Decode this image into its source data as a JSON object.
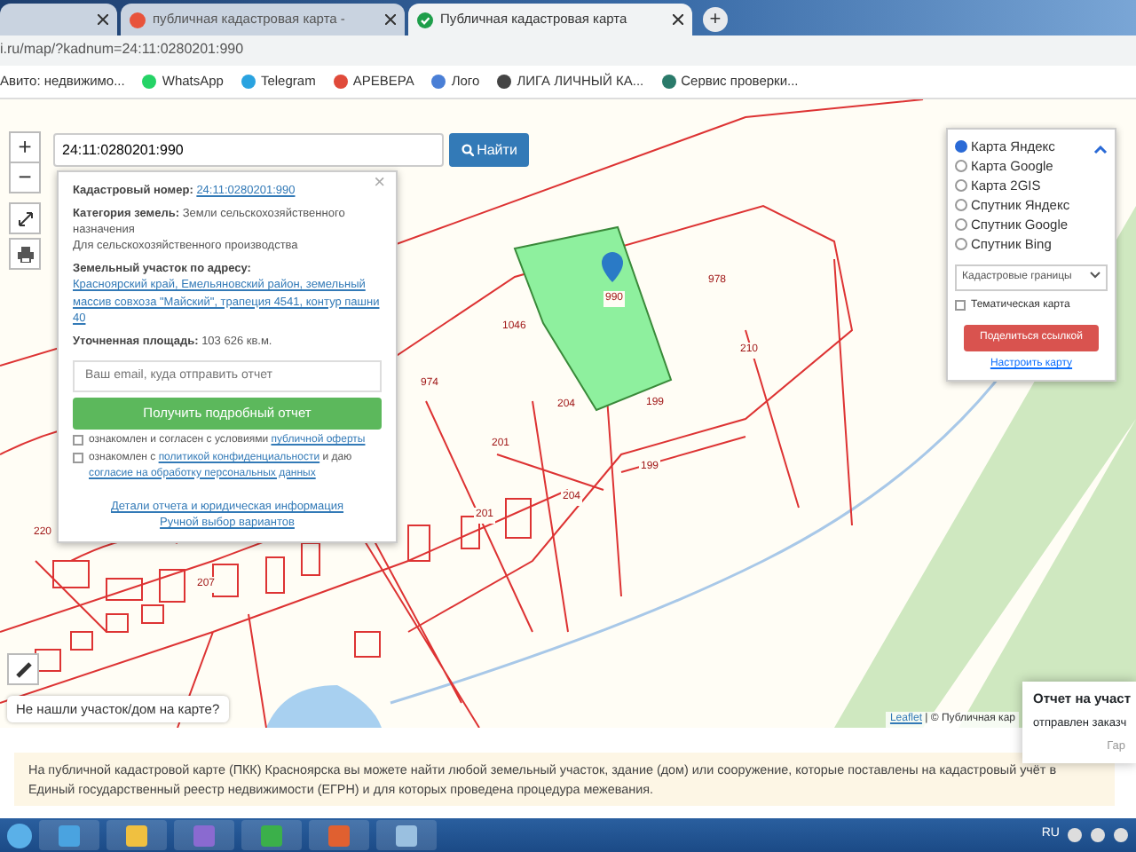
{
  "browser": {
    "tabs": [
      {
        "selected": false
      },
      {
        "title": "публичная кадастровая карта -",
        "selected": false
      },
      {
        "title": "Публичная кадастровая карта",
        "selected": true
      }
    ],
    "new_tab": "+",
    "address": "i.ru/map/?kadnum=24:11:0280201:990",
    "bookmarks": [
      {
        "label": "Авито: недвижимо..."
      },
      {
        "label": "WhatsApp"
      },
      {
        "label": "Telegram"
      },
      {
        "label": "АРЕВЕРА"
      },
      {
        "label": "Лого"
      },
      {
        "label": "ЛИГА ЛИЧНЫЙ КА..."
      },
      {
        "label": "Сервис проверки..."
      }
    ]
  },
  "map": {
    "zoom_in": "+",
    "zoom_out": "−",
    "search": {
      "value": "24:11:0280201:990",
      "button": "Найти"
    },
    "popup": {
      "close": "×",
      "cadastral_label": "Кадастровый номер:",
      "cadastral_value": "24:11:0280201:990",
      "category_label": "Категория земель:",
      "category_value": "Земли сельскохозяйственного назначения",
      "usage": "Для сельскохозяйственного производства",
      "address_label": "Земельный участок по адресу:",
      "address_value": "Красноярский край, Емельяновский район, земельный массив совхоза \"Майский\", трапеция 4541, контур пашни 40",
      "area_label": "Уточненная площадь:",
      "area_value": "103 626 кв.м.",
      "email_placeholder": "Ваш email, куда отправить отчет",
      "report_button": "Получить подробный отчет",
      "consents": [
        {
          "parts": [
            "ознакомлен и согласен с условиями ",
            "публичной оферты"
          ],
          "checked": false
        },
        {
          "parts": [
            "ознакомлен с ",
            "политикой конфиденциальности",
            " и даю ",
            "согласие на обработку персональных данных"
          ],
          "checked": false
        }
      ],
      "links": [
        "Детали отчета и юридическая информация",
        "Ручной выбор вариантов"
      ]
    },
    "layers": [
      {
        "label": "Карта Яндекс",
        "selected": true
      },
      {
        "label": "Карта Google",
        "selected": false
      },
      {
        "label": "Карта 2GIS",
        "selected": false
      },
      {
        "label": "Спутник Яндекс",
        "selected": false
      },
      {
        "label": "Спутник Google",
        "selected": false
      },
      {
        "label": "Спутник Bing",
        "selected": false
      }
    ],
    "boundaries_select": "Кадастровые границы",
    "thematic": {
      "label": "Тематическая карта",
      "checked": false
    },
    "share_button": "Поделиться ссылкой",
    "settings_link": "Настроить карту",
    "not_found": "Не нашли участок/дом на карте?",
    "attribution": {
      "leaflet": "Leaflet",
      "rest": "| © Публичная кар"
    },
    "labels": [
      "990",
      "978",
      "1046",
      "974",
      "204",
      "199",
      "210",
      "201",
      "201",
      "204",
      "199",
      "207",
      "220"
    ]
  },
  "notification": {
    "title": "Отчет на участ",
    "body": "отправлен заказч",
    "action": "Гар"
  },
  "info_text": "На публичной кадастровой карте (ПКК) Красноярска вы можете найти любой земельный участок, здание (дом) или сооружение, которые поставлены на кадастровый учёт в Единый государственный реестр недвижимости (ЕГРН) и для которых проведена процедура межевания.",
  "taskbar": {
    "language": "RU"
  }
}
